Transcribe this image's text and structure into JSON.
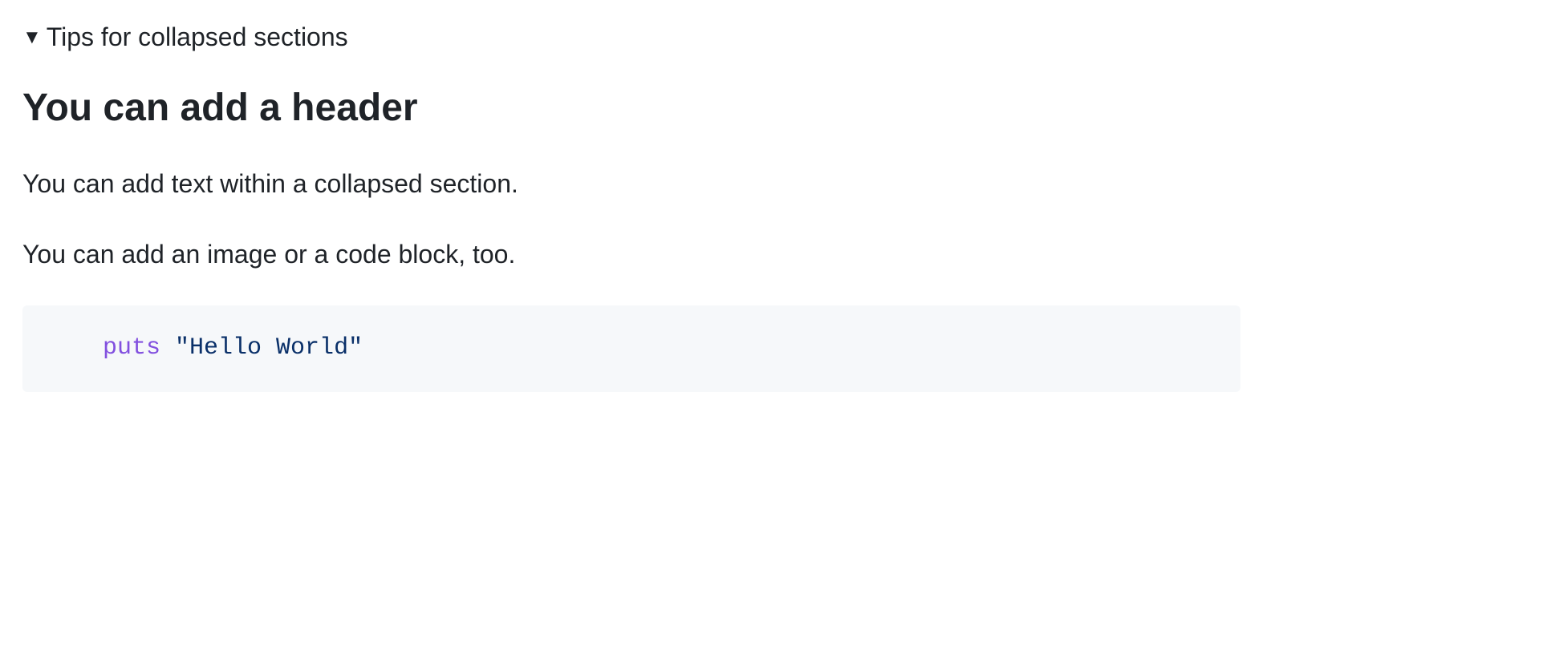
{
  "summary": {
    "label": "Tips for collapsed sections"
  },
  "content": {
    "header": "You can add a header",
    "paragraph1": "You can add text within a collapsed section.",
    "paragraph2": "You can add an image or a code block, too.",
    "code": {
      "keyword": "puts",
      "string": "\"Hello World\""
    }
  }
}
